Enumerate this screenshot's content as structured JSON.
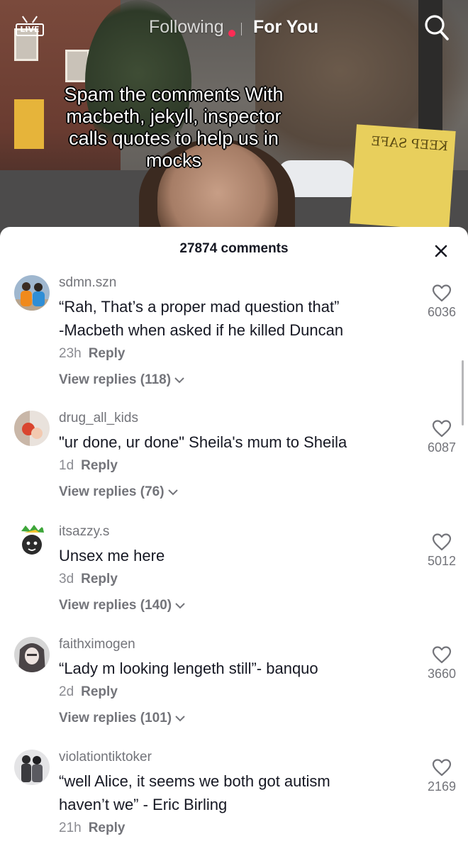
{
  "header": {
    "live_label": "LIVE",
    "tab_following": "Following",
    "tab_foryou": "For You"
  },
  "video": {
    "caption": "Spam the comments With\nmacbeth, jekyll, inspector\ncalls quotes to help us in\nmocks",
    "sign_text": "KEEP SAFE"
  },
  "comments_panel": {
    "count_label": "27874 comments",
    "comments": [
      {
        "username": "sdmn.szn",
        "text": "“Rah, That’s a proper mad question that”\n-Macbeth when asked if he killed Duncan",
        "time": "23h",
        "reply_label": "Reply",
        "view_replies": "View replies (118)",
        "likes": "6036"
      },
      {
        "username": "drug_all_kids",
        "text": "\"ur done, ur done\" Sheila's mum to Sheila",
        "time": "1d",
        "reply_label": "Reply",
        "view_replies": "View replies (76)",
        "likes": "6087"
      },
      {
        "username": "itsazzy.s",
        "text": "Unsex me here",
        "time": "3d",
        "reply_label": "Reply",
        "view_replies": "View replies (140)",
        "likes": "5012"
      },
      {
        "username": "faithximogen",
        "text": "“Lady m looking lengeth still”- banquo",
        "time": "2d",
        "reply_label": "Reply",
        "view_replies": "View replies (101)",
        "likes": "3660"
      },
      {
        "username": "violationtiktoker",
        "text": "“well Alice, it seems we both got autism\nhaven’t we” - Eric Birling",
        "time": "21h",
        "reply_label": "Reply",
        "view_replies": "",
        "likes": "2169"
      }
    ]
  },
  "colors": {
    "accent_dot": "#fe2c55",
    "primary_text": "#161823",
    "secondary_text": "#73747a"
  }
}
